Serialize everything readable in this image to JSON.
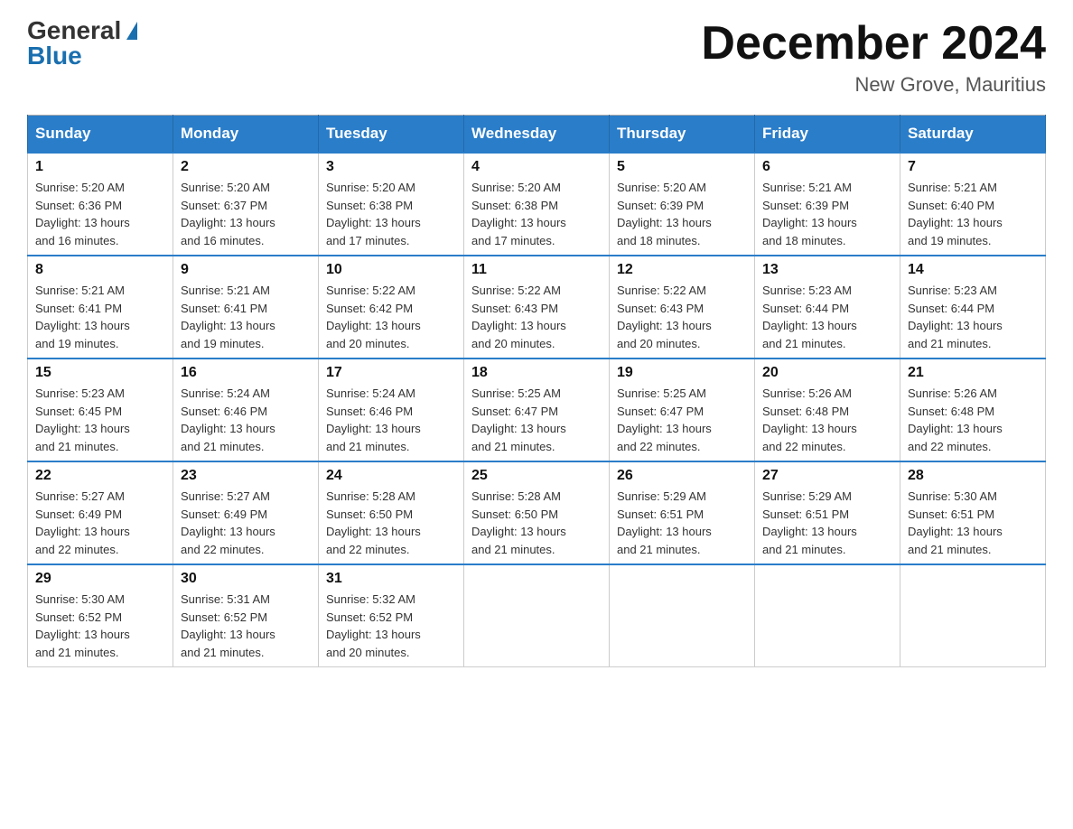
{
  "header": {
    "logo_general": "General",
    "logo_blue": "Blue",
    "month_title": "December 2024",
    "location": "New Grove, Mauritius"
  },
  "days_of_week": [
    "Sunday",
    "Monday",
    "Tuesday",
    "Wednesday",
    "Thursday",
    "Friday",
    "Saturday"
  ],
  "weeks": [
    [
      {
        "day": "1",
        "sunrise": "5:20 AM",
        "sunset": "6:36 PM",
        "daylight": "13 hours and 16 minutes."
      },
      {
        "day": "2",
        "sunrise": "5:20 AM",
        "sunset": "6:37 PM",
        "daylight": "13 hours and 16 minutes."
      },
      {
        "day": "3",
        "sunrise": "5:20 AM",
        "sunset": "6:38 PM",
        "daylight": "13 hours and 17 minutes."
      },
      {
        "day": "4",
        "sunrise": "5:20 AM",
        "sunset": "6:38 PM",
        "daylight": "13 hours and 17 minutes."
      },
      {
        "day": "5",
        "sunrise": "5:20 AM",
        "sunset": "6:39 PM",
        "daylight": "13 hours and 18 minutes."
      },
      {
        "day": "6",
        "sunrise": "5:21 AM",
        "sunset": "6:39 PM",
        "daylight": "13 hours and 18 minutes."
      },
      {
        "day": "7",
        "sunrise": "5:21 AM",
        "sunset": "6:40 PM",
        "daylight": "13 hours and 19 minutes."
      }
    ],
    [
      {
        "day": "8",
        "sunrise": "5:21 AM",
        "sunset": "6:41 PM",
        "daylight": "13 hours and 19 minutes."
      },
      {
        "day": "9",
        "sunrise": "5:21 AM",
        "sunset": "6:41 PM",
        "daylight": "13 hours and 19 minutes."
      },
      {
        "day": "10",
        "sunrise": "5:22 AM",
        "sunset": "6:42 PM",
        "daylight": "13 hours and 20 minutes."
      },
      {
        "day": "11",
        "sunrise": "5:22 AM",
        "sunset": "6:43 PM",
        "daylight": "13 hours and 20 minutes."
      },
      {
        "day": "12",
        "sunrise": "5:22 AM",
        "sunset": "6:43 PM",
        "daylight": "13 hours and 20 minutes."
      },
      {
        "day": "13",
        "sunrise": "5:23 AM",
        "sunset": "6:44 PM",
        "daylight": "13 hours and 21 minutes."
      },
      {
        "day": "14",
        "sunrise": "5:23 AM",
        "sunset": "6:44 PM",
        "daylight": "13 hours and 21 minutes."
      }
    ],
    [
      {
        "day": "15",
        "sunrise": "5:23 AM",
        "sunset": "6:45 PM",
        "daylight": "13 hours and 21 minutes."
      },
      {
        "day": "16",
        "sunrise": "5:24 AM",
        "sunset": "6:46 PM",
        "daylight": "13 hours and 21 minutes."
      },
      {
        "day": "17",
        "sunrise": "5:24 AM",
        "sunset": "6:46 PM",
        "daylight": "13 hours and 21 minutes."
      },
      {
        "day": "18",
        "sunrise": "5:25 AM",
        "sunset": "6:47 PM",
        "daylight": "13 hours and 21 minutes."
      },
      {
        "day": "19",
        "sunrise": "5:25 AM",
        "sunset": "6:47 PM",
        "daylight": "13 hours and 22 minutes."
      },
      {
        "day": "20",
        "sunrise": "5:26 AM",
        "sunset": "6:48 PM",
        "daylight": "13 hours and 22 minutes."
      },
      {
        "day": "21",
        "sunrise": "5:26 AM",
        "sunset": "6:48 PM",
        "daylight": "13 hours and 22 minutes."
      }
    ],
    [
      {
        "day": "22",
        "sunrise": "5:27 AM",
        "sunset": "6:49 PM",
        "daylight": "13 hours and 22 minutes."
      },
      {
        "day": "23",
        "sunrise": "5:27 AM",
        "sunset": "6:49 PM",
        "daylight": "13 hours and 22 minutes."
      },
      {
        "day": "24",
        "sunrise": "5:28 AM",
        "sunset": "6:50 PM",
        "daylight": "13 hours and 22 minutes."
      },
      {
        "day": "25",
        "sunrise": "5:28 AM",
        "sunset": "6:50 PM",
        "daylight": "13 hours and 21 minutes."
      },
      {
        "day": "26",
        "sunrise": "5:29 AM",
        "sunset": "6:51 PM",
        "daylight": "13 hours and 21 minutes."
      },
      {
        "day": "27",
        "sunrise": "5:29 AM",
        "sunset": "6:51 PM",
        "daylight": "13 hours and 21 minutes."
      },
      {
        "day": "28",
        "sunrise": "5:30 AM",
        "sunset": "6:51 PM",
        "daylight": "13 hours and 21 minutes."
      }
    ],
    [
      {
        "day": "29",
        "sunrise": "5:30 AM",
        "sunset": "6:52 PM",
        "daylight": "13 hours and 21 minutes."
      },
      {
        "day": "30",
        "sunrise": "5:31 AM",
        "sunset": "6:52 PM",
        "daylight": "13 hours and 21 minutes."
      },
      {
        "day": "31",
        "sunrise": "5:32 AM",
        "sunset": "6:52 PM",
        "daylight": "13 hours and 20 minutes."
      },
      null,
      null,
      null,
      null
    ]
  ],
  "labels": {
    "sunrise": "Sunrise:",
    "sunset": "Sunset:",
    "daylight": "Daylight:"
  }
}
